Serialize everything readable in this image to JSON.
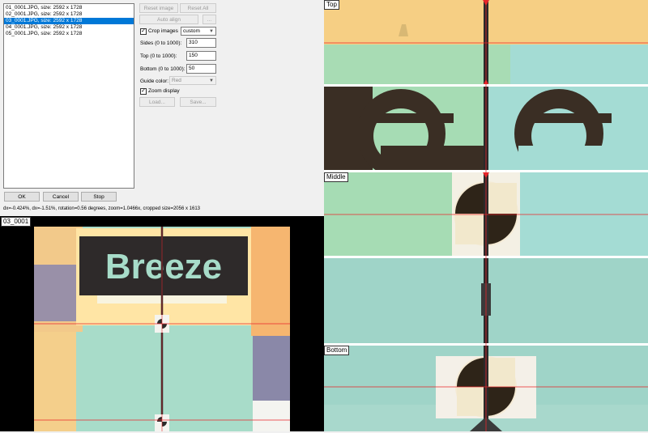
{
  "files": [
    "01_0001.JPG, size: 2592 x 1728",
    "02_0001.JPG, size: 2592 x 1728",
    "03_0001.JPG, size: 2592 x 1728",
    "04_0001.JPG, size: 2592 x 1728",
    "05_0001.JPG, size: 2592 x 1728"
  ],
  "selected_file_index": 2,
  "buttons": {
    "reset_image": "Reset image",
    "reset_all": "Reset All",
    "auto_align": "Auto align",
    "ellipsis": "...",
    "load": "Load...",
    "save": "Save...",
    "ok": "OK",
    "cancel": "Cancel",
    "stop": "Stop"
  },
  "crop": {
    "checkbox_label": "Crop images",
    "checked": true,
    "mode": "custom",
    "sides_label": "Sides (0 to 1000):",
    "sides_value": "310",
    "top_label": "Top (0 to 1000):",
    "top_value": "150",
    "bottom_label": "Bottom (0 to 1000):",
    "bottom_value": "50"
  },
  "guide_color": {
    "label": "Guide color:",
    "value": "Red"
  },
  "zoom_display": {
    "label": "Zoom display",
    "checked": true
  },
  "status": "dx=-0.424%, dx=-1.51%, rotation=0.56 degrees, zoom=1.0466x, cropped size=2056 x 1613",
  "preview": {
    "title": "03_0001",
    "sign_text": "Breeze"
  },
  "views": {
    "top": "Top",
    "middle": "Middle",
    "bottom": "Bottom"
  },
  "colors": {
    "accent": "#0078d7",
    "guide": "#e8262a"
  }
}
